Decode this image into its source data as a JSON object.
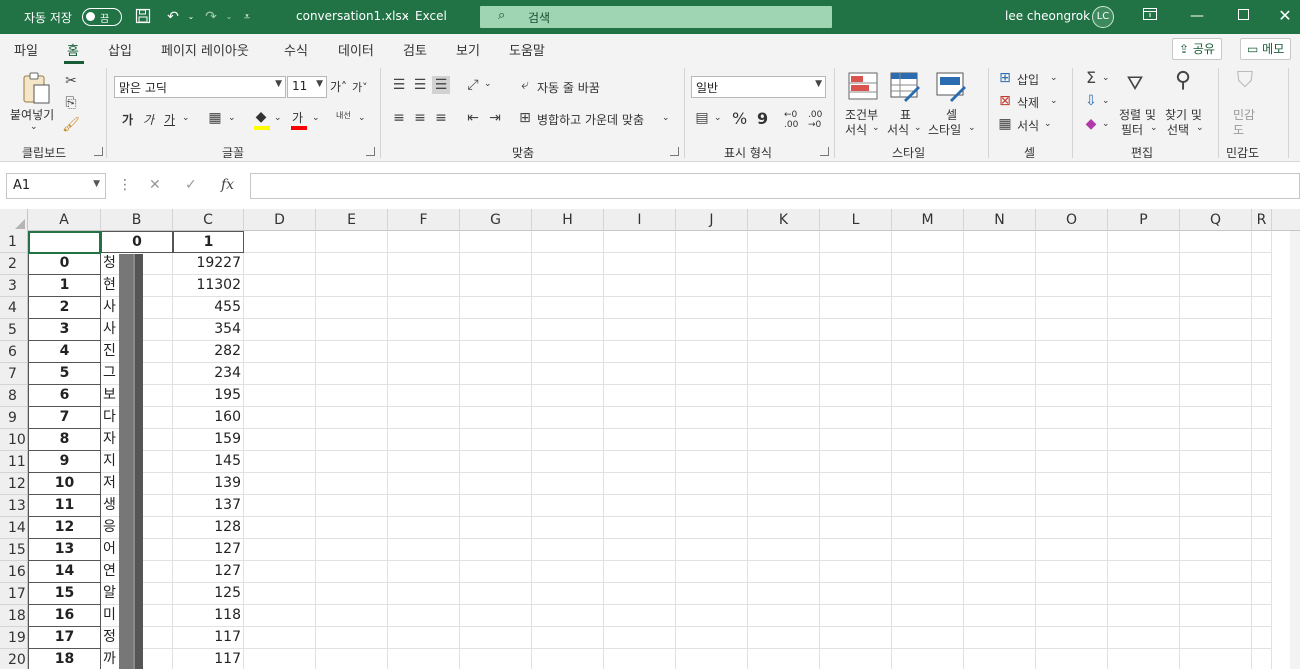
{
  "titlebar": {
    "autosave_label": "자동 저장",
    "autosave_state": "끔",
    "filename": "conversation1.xlsx",
    "separator": "-",
    "app_name": "Excel",
    "search_placeholder": "검색",
    "user_name": "lee cheongrok",
    "user_initials": "LC"
  },
  "menu_tabs": [
    "파일",
    "홈",
    "삽입",
    "페이지 레이아웃",
    "수식",
    "데이터",
    "검토",
    "보기",
    "도움말"
  ],
  "active_tab": "홈",
  "share_label": "공유",
  "memo_label": "메모",
  "ribbon": {
    "clipboard": {
      "paste_label": "붙여넣기",
      "group_label": "클립보드"
    },
    "font": {
      "font_name": "맑은 고딕",
      "font_size": "11",
      "bold": "가",
      "italic": "가",
      "underline": "가",
      "font_color_glyph": "가",
      "phonetic": "내선",
      "group_label": "글꼴"
    },
    "alignment": {
      "wrap_text": "자동 줄 바꿈",
      "merge_center": "병합하고 가운데 맞춤",
      "group_label": "맞춤"
    },
    "number": {
      "format": "일반",
      "percent": "%",
      "comma": "9",
      "group_label": "표시 형식"
    },
    "styles": {
      "conditional_1": "조건부",
      "conditional_2": "서식",
      "table_1": "표",
      "table_2": "서식",
      "cell_styles_1": "셀",
      "cell_styles_2": "스타일",
      "group_label": "스타일"
    },
    "cells": {
      "insert": "삽입",
      "delete": "삭제",
      "format": "서식",
      "group_label": "셀"
    },
    "editing": {
      "sort_1": "정렬 및",
      "sort_2": "필터",
      "find_1": "찾기 및",
      "find_2": "선택",
      "group_label": "편집"
    },
    "sensitivity": {
      "label_1": "민감",
      "label_2": "도",
      "group_label": "민감도"
    }
  },
  "formula_bar": {
    "name_box": "A1",
    "fx": "fx",
    "content": ""
  },
  "columns": [
    "A",
    "B",
    "C",
    "D",
    "E",
    "F",
    "G",
    "H",
    "I",
    "J",
    "K",
    "L",
    "M",
    "N",
    "O",
    "P",
    "Q",
    "R"
  ],
  "header_row": {
    "b": "0",
    "c": "1"
  },
  "rows": [
    {
      "row": "2",
      "index": "0",
      "word": "청",
      "count": "19227"
    },
    {
      "row": "3",
      "index": "1",
      "word": "현",
      "count": "11302"
    },
    {
      "row": "4",
      "index": "2",
      "word": "사",
      "count": "455"
    },
    {
      "row": "5",
      "index": "3",
      "word": "사",
      "count": "354"
    },
    {
      "row": "6",
      "index": "4",
      "word": "진",
      "count": "282"
    },
    {
      "row": "7",
      "index": "5",
      "word": "그",
      "count": "234"
    },
    {
      "row": "8",
      "index": "6",
      "word": "보",
      "count": "195"
    },
    {
      "row": "9",
      "index": "7",
      "word": "다",
      "count": "160"
    },
    {
      "row": "10",
      "index": "8",
      "word": "자",
      "count": "159"
    },
    {
      "row": "11",
      "index": "9",
      "word": "지",
      "count": "145"
    },
    {
      "row": "12",
      "index": "10",
      "word": "저",
      "count": "139"
    },
    {
      "row": "13",
      "index": "11",
      "word": "생",
      "count": "137"
    },
    {
      "row": "14",
      "index": "12",
      "word": "응",
      "count": "128"
    },
    {
      "row": "15",
      "index": "13",
      "word": "어",
      "count": "127"
    },
    {
      "row": "16",
      "index": "14",
      "word": "연",
      "count": "127"
    },
    {
      "row": "17",
      "index": "15",
      "word": "알",
      "count": "125"
    },
    {
      "row": "18",
      "index": "16",
      "word": "미",
      "count": "118"
    },
    {
      "row": "19",
      "index": "17",
      "word": "정",
      "count": "117"
    },
    {
      "row": "20",
      "index": "18",
      "word": "까",
      "count": "117"
    }
  ],
  "first_row_number": "1",
  "colors": {
    "excel_green": "#217346",
    "dark_green": "#185c37"
  }
}
